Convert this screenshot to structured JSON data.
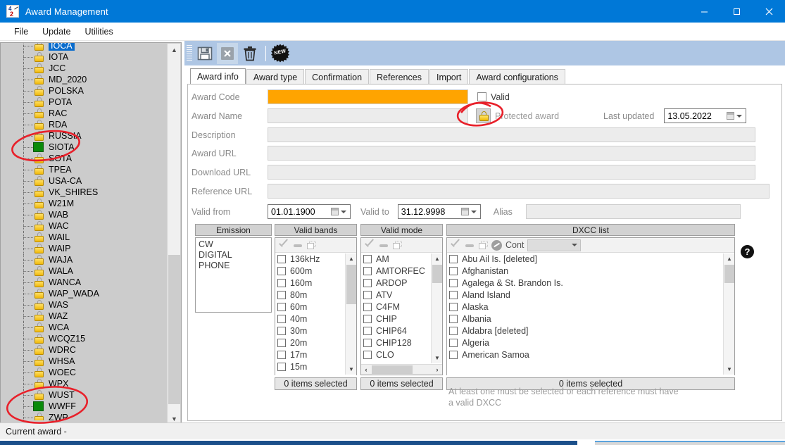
{
  "window": {
    "title": "Award Management",
    "icon": "app-icon",
    "minimize": "minimize-icon",
    "maximize": "maximize-icon",
    "close": "close-icon"
  },
  "menubar": {
    "items": [
      "File",
      "Update",
      "Utilities"
    ]
  },
  "tree": {
    "items": [
      {
        "label": "IOCA",
        "icon": "lock-icon",
        "selected": true
      },
      {
        "label": "IOTA",
        "icon": "lock-icon",
        "selected": false
      },
      {
        "label": "JCC",
        "icon": "lock-icon",
        "selected": false
      },
      {
        "label": "MD_2020",
        "icon": "lock-icon",
        "selected": false
      },
      {
        "label": "POLSKA",
        "icon": "lock-icon",
        "selected": false
      },
      {
        "label": "POTA",
        "icon": "lock-icon",
        "selected": false
      },
      {
        "label": "RAC",
        "icon": "lock-icon",
        "selected": false
      },
      {
        "label": "RDA",
        "icon": "lock-icon",
        "selected": false
      },
      {
        "label": "RUSSIA",
        "icon": "lock-icon",
        "selected": false
      },
      {
        "label": "SIOTA",
        "icon": "green-square-icon",
        "selected": false
      },
      {
        "label": "SOTA",
        "icon": "lock-icon",
        "selected": false
      },
      {
        "label": "TPEA",
        "icon": "lock-icon",
        "selected": false
      },
      {
        "label": "USA-CA",
        "icon": "lock-icon",
        "selected": false
      },
      {
        "label": "VK_SHIRES",
        "icon": "lock-icon",
        "selected": false
      },
      {
        "label": "W21M",
        "icon": "lock-icon",
        "selected": false
      },
      {
        "label": "WAB",
        "icon": "lock-icon",
        "selected": false
      },
      {
        "label": "WAC",
        "icon": "lock-icon",
        "selected": false
      },
      {
        "label": "WAIL",
        "icon": "lock-icon",
        "selected": false
      },
      {
        "label": "WAIP",
        "icon": "lock-icon",
        "selected": false
      },
      {
        "label": "WAJA",
        "icon": "lock-icon",
        "selected": false
      },
      {
        "label": "WALA",
        "icon": "lock-icon",
        "selected": false
      },
      {
        "label": "WANCA",
        "icon": "lock-icon",
        "selected": false
      },
      {
        "label": "WAP_WADA",
        "icon": "lock-icon",
        "selected": false
      },
      {
        "label": "WAS",
        "icon": "lock-icon",
        "selected": false
      },
      {
        "label": "WAZ",
        "icon": "lock-icon",
        "selected": false
      },
      {
        "label": "WCA",
        "icon": "lock-icon",
        "selected": false
      },
      {
        "label": "WCQZ15",
        "icon": "lock-icon",
        "selected": false
      },
      {
        "label": "WDRC",
        "icon": "lock-icon",
        "selected": false
      },
      {
        "label": "WHSA",
        "icon": "lock-icon",
        "selected": false
      },
      {
        "label": "WOEC",
        "icon": "lock-icon",
        "selected": false
      },
      {
        "label": "WPX",
        "icon": "lock-icon",
        "selected": false
      },
      {
        "label": "WUST",
        "icon": "lock-icon",
        "selected": false
      },
      {
        "label": "WWFF",
        "icon": "green-square-icon",
        "selected": false
      },
      {
        "label": "ZWP",
        "icon": "lock-icon",
        "selected": false
      }
    ]
  },
  "toolbar": {
    "save": "save-icon",
    "cancel": "cancel-icon",
    "delete": "delete-icon",
    "new_badge": "NEW"
  },
  "tabs": [
    {
      "label": "Award info",
      "active": true
    },
    {
      "label": "Award type",
      "active": false
    },
    {
      "label": "Confirmation",
      "active": false
    },
    {
      "label": "References",
      "active": false
    },
    {
      "label": "Import",
      "active": false
    },
    {
      "label": "Award configurations",
      "active": false
    }
  ],
  "form": {
    "award_code_label": "Award Code",
    "award_code_value": "",
    "award_code_color": "#ffa400",
    "valid_checkbox_label": "Valid",
    "award_name_label": "Award Name",
    "award_name_value": "",
    "protected_award_label": "Protected award",
    "protected_icon": "lock-icon",
    "last_updated_label": "Last updated",
    "last_updated_value": "13.05.2022",
    "description_label": "Description",
    "description_value": "",
    "award_url_label": "Award URL",
    "award_url_value": "",
    "download_url_label": "Download URL",
    "download_url_value": "",
    "reference_url_label": "Reference URL",
    "reference_url_value": "",
    "valid_from_label": "Valid from",
    "valid_from_value": "01.01.1900",
    "valid_to_label": "Valid to",
    "valid_to_value": "31.12.9998",
    "alias_label": "Alias",
    "alias_value": "",
    "help_icon": "help-icon"
  },
  "emission": {
    "header": "Emission",
    "items": [
      "CW",
      "DIGITAL",
      "PHONE"
    ]
  },
  "valid_bands": {
    "header": "Valid bands",
    "items": [
      "136kHz",
      "600m",
      "160m",
      "80m",
      "60m",
      "40m",
      "30m",
      "20m",
      "17m",
      "15m"
    ],
    "status": "0 items selected"
  },
  "valid_mode": {
    "header": "Valid mode",
    "items": [
      "AM",
      "AMTORFEC",
      "ARDOP",
      "ATV",
      "C4FM",
      "CHIP",
      "CHIP64",
      "CHIP128",
      "CLO"
    ],
    "status": "0 items selected"
  },
  "dxcc": {
    "header": "DXCC list",
    "cont_label": "Cont",
    "cont_value": "",
    "items": [
      "Abu Ail Is. [deleted]",
      "Afghanistan",
      "Agalega & St. Brandon Is.",
      "Aland Island",
      "Alaska",
      "Albania",
      "Aldabra [deleted]",
      "Algeria",
      "American Samoa"
    ],
    "status": "0 items selected",
    "hint": "At least one must be selected or each reference must have a valid DXCC"
  },
  "statusbar": {
    "text": "Current award  -"
  }
}
